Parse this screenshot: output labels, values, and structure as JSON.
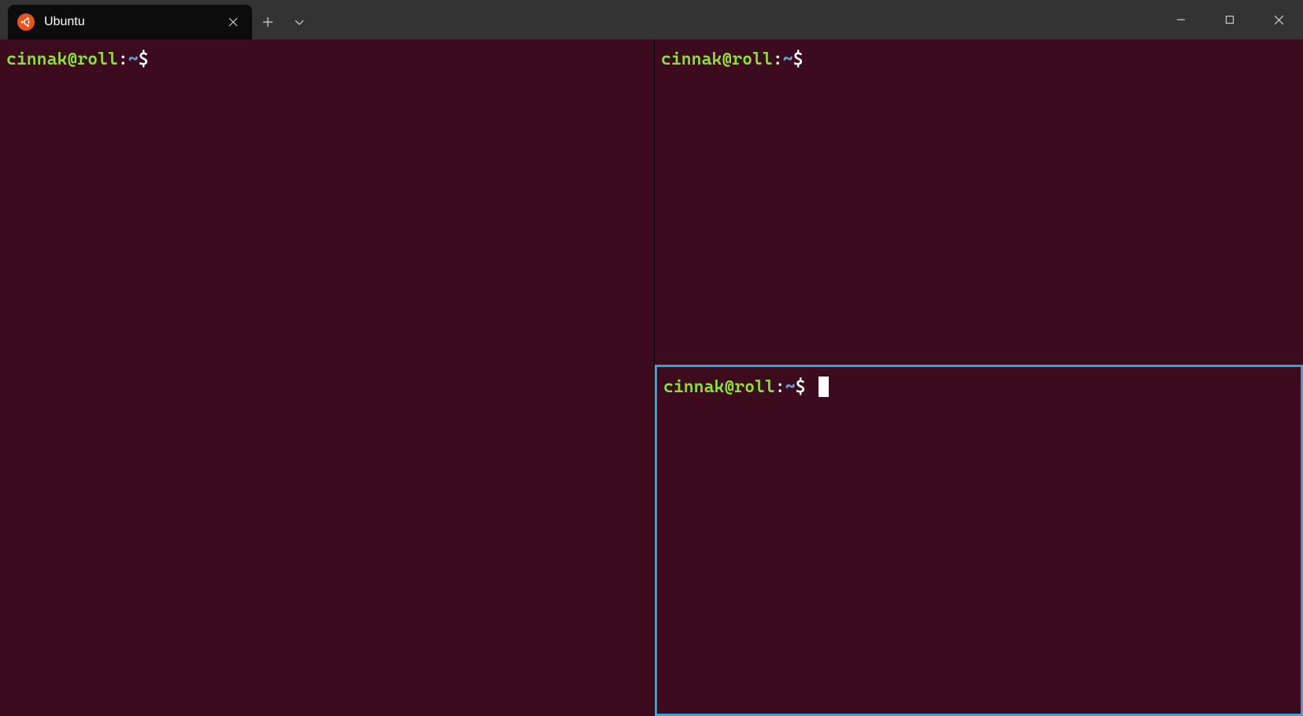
{
  "tab": {
    "title": "Ubuntu"
  },
  "panes": {
    "left": {
      "prompt_user": "cinnak@roll",
      "prompt_colon": ":",
      "prompt_path": "~",
      "prompt_dollar": "$",
      "has_cursor": false
    },
    "top_right": {
      "prompt_user": "cinnak@roll",
      "prompt_colon": ":",
      "prompt_path": "~",
      "prompt_dollar": "$",
      "has_cursor": false
    },
    "bottom_right": {
      "prompt_user": "cinnak@roll",
      "prompt_colon": ":",
      "prompt_path": "~",
      "prompt_dollar": "$",
      "has_cursor": true,
      "is_focused": true
    }
  },
  "colors": {
    "terminal_bg": "#3d0b1e",
    "titlebar_bg": "#333333",
    "tab_bg": "#0c0c0c",
    "focus_border": "#3aa0d8",
    "prompt_green": "#8ae234",
    "prompt_blue": "#729fcf",
    "ubuntu_orange": "#E95420"
  }
}
